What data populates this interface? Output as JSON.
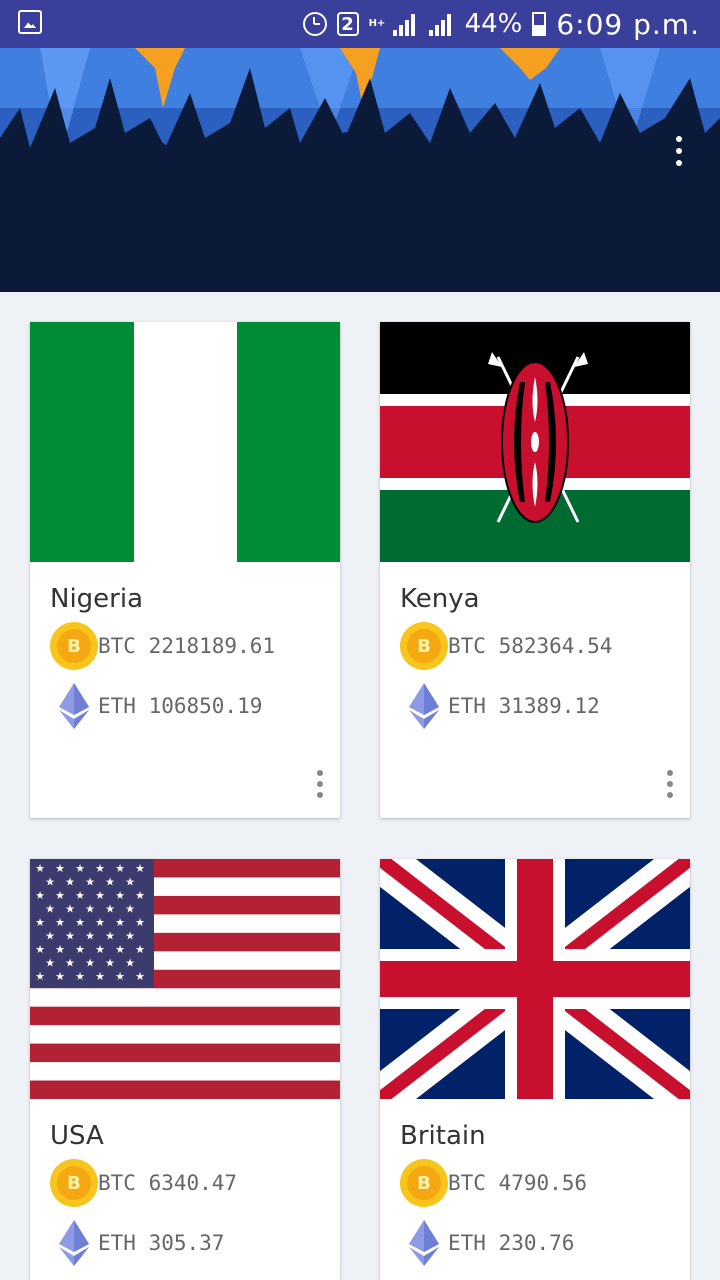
{
  "status_bar": {
    "notification_badge": "2",
    "network_type": "H+",
    "battery": "44%",
    "time": "6:09 p.m."
  },
  "header": {
    "menu_icon": "more-vert-icon"
  },
  "cards": [
    {
      "country": "Nigeria",
      "btc_label": "BTC 2218189.61",
      "eth_label": "ETH 106850.19",
      "flag": "nigeria-flag"
    },
    {
      "country": "Kenya",
      "btc_label": "BTC 582364.54",
      "eth_label": "ETH 31389.12",
      "flag": "kenya-flag"
    },
    {
      "country": "USA",
      "btc_label": "BTC 6340.47",
      "eth_label": "ETH 305.37",
      "flag": "usa-flag"
    },
    {
      "country": "Britain",
      "btc_label": "BTC 4790.56",
      "eth_label": "ETH 230.76",
      "flag": "uk-flag"
    }
  ],
  "colors": {
    "status_bar": "#3b3f9c",
    "header_bg": "#0c1a3a",
    "bitcoin": "#f5a812",
    "ethereum": "#6f7fd6"
  },
  "btc_symbol": "B"
}
